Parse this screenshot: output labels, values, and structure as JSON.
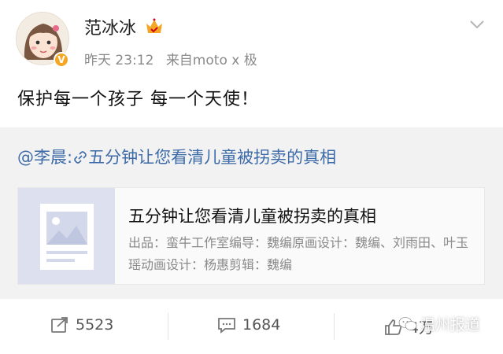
{
  "post": {
    "username": "范冰冰",
    "time": "昨天 23:12",
    "source": "来自moto x 极",
    "text": "保护每一个孩子 每一个天使！"
  },
  "repost": {
    "mention": "@李晨:",
    "link_text": "五分钟让您看清儿童被拐卖的真相"
  },
  "card": {
    "title": "五分钟让您看清儿童被拐卖的真相",
    "description": "出品：蛮牛工作室编导：魏编原画设计：魏编、刘雨田、叶玉瑶动画设计：杨惠剪辑：魏编"
  },
  "actions": {
    "repost_count": "5523",
    "comment_count": "1684",
    "like_count": "4万"
  },
  "watermark": "温州报道",
  "colors": {
    "link_blue": "#3d6ba8",
    "verified_orange": "#f5a623",
    "repost_bg": "#f2f2f2"
  }
}
